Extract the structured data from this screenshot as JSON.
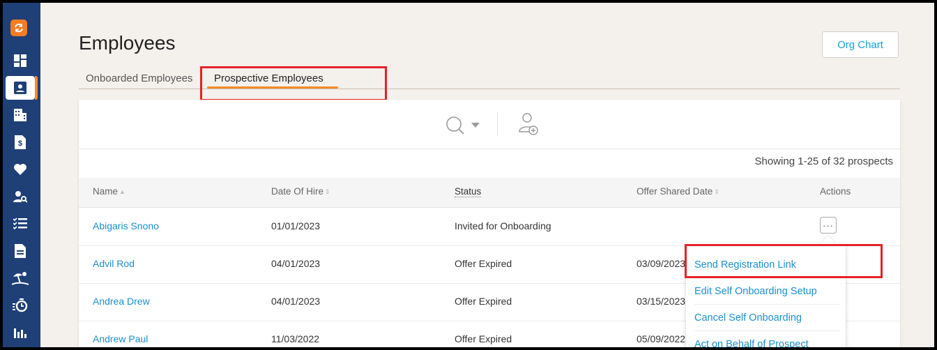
{
  "app": {
    "logo_icon": "sync-logo-icon"
  },
  "sidebar": {
    "items": [
      {
        "icon": "dashboard-icon"
      },
      {
        "icon": "employee-id-icon",
        "active": true
      },
      {
        "icon": "building-icon"
      },
      {
        "icon": "payroll-document-icon"
      },
      {
        "icon": "heart-icon"
      },
      {
        "icon": "user-search-icon"
      },
      {
        "icon": "checklist-icon"
      },
      {
        "icon": "document-icon"
      },
      {
        "icon": "beach-vacation-icon"
      },
      {
        "icon": "timer-icon"
      },
      {
        "icon": "reports-chart-icon"
      }
    ]
  },
  "header": {
    "title": "Employees",
    "org_chart_label": "Org Chart"
  },
  "tabs": [
    {
      "label": "Onboarded Employees",
      "active": false
    },
    {
      "label": "Prospective Employees",
      "active": true
    }
  ],
  "toolbar": {
    "search_icon": "search-icon",
    "add_icon": "add-user-icon"
  },
  "table": {
    "showing": "Showing 1-25 of 32 prospects",
    "columns": [
      "Name",
      "Date Of Hire",
      "Status",
      "Offer Shared Date",
      "Actions"
    ],
    "rows": [
      {
        "name": "Abigaris Snono",
        "date_of_hire": "01/01/2023",
        "status": "Invited for Onboarding",
        "offer_shared_date": ""
      },
      {
        "name": "Advil Rod",
        "date_of_hire": "04/01/2023",
        "status": "Offer Expired",
        "offer_shared_date": "03/09/2023"
      },
      {
        "name": "Andrea Drew",
        "date_of_hire": "04/01/2023",
        "status": "Offer Expired",
        "offer_shared_date": "03/15/2023"
      },
      {
        "name": "Andrew Paul",
        "date_of_hire": "11/03/2022",
        "status": "Offer Expired",
        "offer_shared_date": "05/09/2022"
      }
    ],
    "actions_button_label": "···"
  },
  "actions_menu": {
    "items": [
      "Send Registration Link",
      "Edit Self Onboarding Setup",
      "Cancel Self Onboarding",
      "Act on Behalf of Prospect"
    ]
  },
  "colors": {
    "sidebar": "#1f3f77",
    "accent": "#f28c28",
    "link": "#1a8fd0",
    "highlight": "#e52228"
  }
}
